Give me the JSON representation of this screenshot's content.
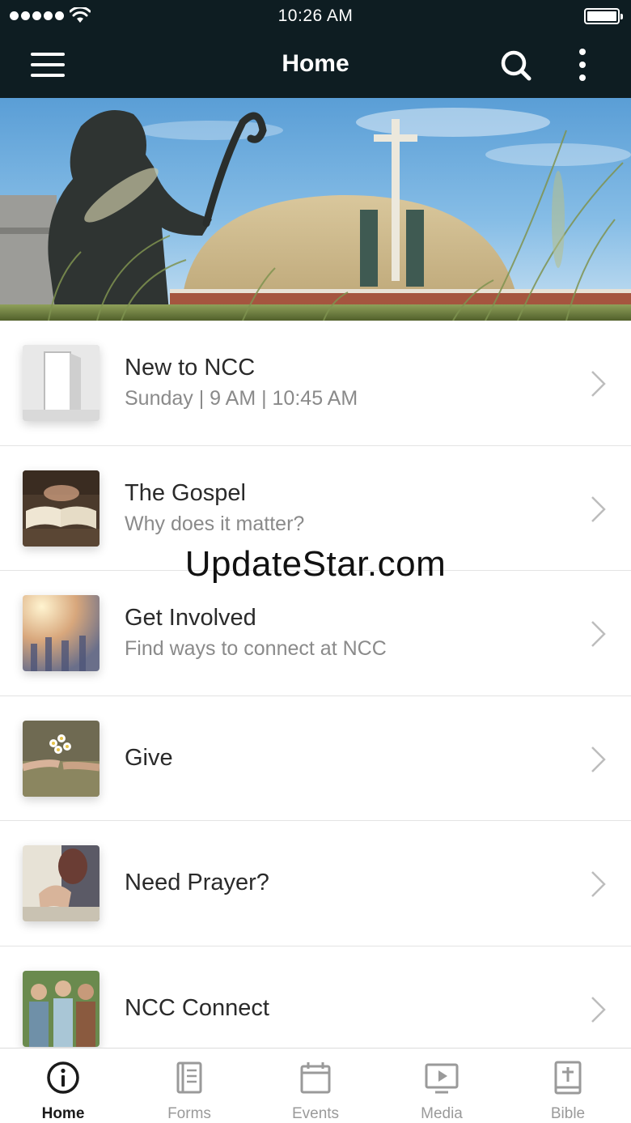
{
  "status_bar": {
    "time": "10:26 AM"
  },
  "nav": {
    "title": "Home"
  },
  "list": [
    {
      "title": "New to NCC",
      "subtitle": "Sunday | 9 AM | 10:45 AM"
    },
    {
      "title": "The Gospel",
      "subtitle": "Why does it matter?"
    },
    {
      "title": "Get Involved",
      "subtitle": "Find ways to connect at NCC"
    },
    {
      "title": "Give",
      "subtitle": ""
    },
    {
      "title": "Need Prayer?",
      "subtitle": ""
    },
    {
      "title": "NCC Connect",
      "subtitle": ""
    }
  ],
  "watermark": "UpdateStar.com",
  "tabs": [
    {
      "label": "Home",
      "icon": "info-circle-icon",
      "active": true
    },
    {
      "label": "Forms",
      "icon": "forms-icon",
      "active": false
    },
    {
      "label": "Events",
      "icon": "calendar-icon",
      "active": false
    },
    {
      "label": "Media",
      "icon": "media-play-icon",
      "active": false
    },
    {
      "label": "Bible",
      "icon": "bible-icon",
      "active": false
    }
  ],
  "colors": {
    "bar_background": "#0e1d22",
    "active_tab": "#1a1a1a",
    "inactive_tab": "#9a9a9a"
  }
}
